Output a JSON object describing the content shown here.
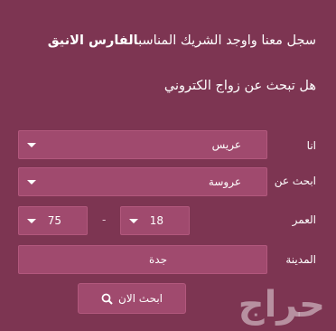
{
  "header": {
    "title_text": "سجل معنا واوجد الشريك المناسب",
    "title_bold": "الفارس الانيق",
    "subtitle": "هل تبحث عن زواج الكتروني"
  },
  "form": {
    "i_am": {
      "label": "انا",
      "value": "عريس"
    },
    "looking_for": {
      "label": "ابحث عن",
      "value": "عروسة"
    },
    "age": {
      "label": "العمر",
      "from": "18",
      "to": "75",
      "separator": "-"
    },
    "city": {
      "label": "المدينة",
      "value": "جدة"
    },
    "search_button": "ابحث الان"
  },
  "watermark": "حراج"
}
